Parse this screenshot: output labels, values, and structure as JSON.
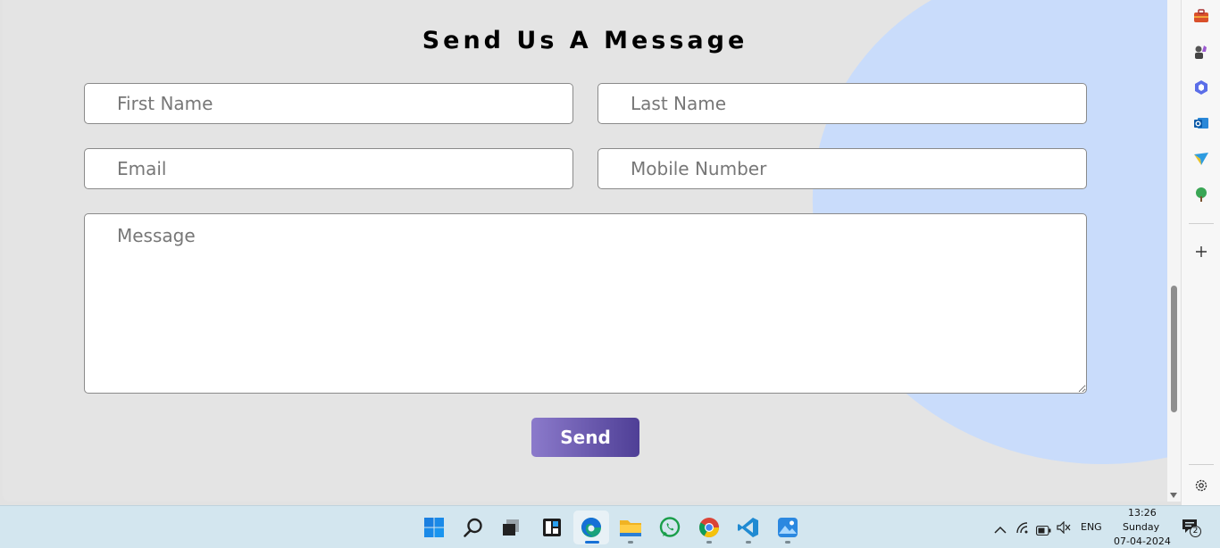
{
  "form": {
    "title": "Send Us A Message",
    "first_name_placeholder": "First Name",
    "last_name_placeholder": "Last Name",
    "email_placeholder": "Email",
    "mobile_placeholder": "Mobile Number",
    "message_placeholder": "Message",
    "send_label": "Send"
  },
  "colors": {
    "accent_start": "#8b7acb",
    "accent_end": "#4f3f96",
    "blob": "#c9dcfb",
    "background": "#e4e4e4"
  },
  "sidepanel": {
    "icons": [
      "briefcase-icon",
      "games-icon",
      "copilot-icon",
      "outlook-icon",
      "send-icon",
      "tree-icon",
      "add-icon",
      "settings-icon"
    ]
  },
  "taskbar": {
    "apps": [
      "start-icon",
      "search-icon",
      "task-view-icon",
      "widgets-icon",
      "edge-icon",
      "file-explorer-icon",
      "whatsapp-icon",
      "chrome-icon",
      "vscode-icon",
      "photos-icon"
    ],
    "tray": {
      "language": "ENG",
      "time": "13:26",
      "day": "Sunday",
      "date": "07-04-2024",
      "notification_count": "2"
    }
  }
}
